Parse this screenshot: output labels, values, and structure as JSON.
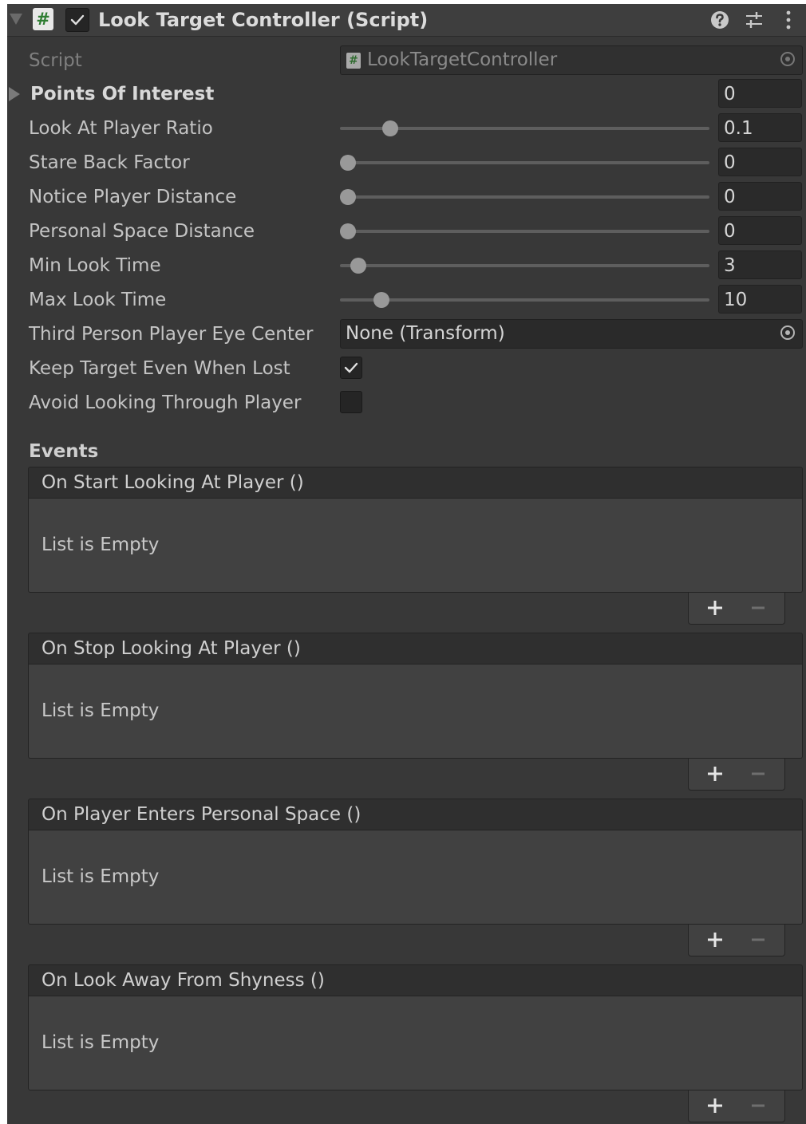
{
  "component": {
    "title": "Look Target Controller (Script)",
    "script_icon_glyph": "#",
    "enabled": true,
    "header_icons": [
      "help-icon",
      "presets-icon",
      "kebab-menu-icon"
    ]
  },
  "script_field": {
    "label": "Script",
    "value": "LookTargetController"
  },
  "points_of_interest": {
    "label": "Points Of Interest",
    "count": "0"
  },
  "sliders": [
    {
      "label": "Look At Player Ratio",
      "value": "0.1",
      "fraction": 0.12
    },
    {
      "label": "Stare Back Factor",
      "value": "0",
      "fraction": 0.0
    },
    {
      "label": "Notice Player Distance",
      "value": "0",
      "fraction": 0.0
    },
    {
      "label": "Personal Space Distance",
      "value": "0",
      "fraction": 0.0
    },
    {
      "label": "Min Look Time",
      "value": "3",
      "fraction": 0.03
    },
    {
      "label": "Max Look Time",
      "value": "10",
      "fraction": 0.095
    }
  ],
  "eye_center": {
    "label": "Third Person Player Eye Center",
    "value": "None (Transform)"
  },
  "toggles": [
    {
      "label": "Keep Target Even When Lost",
      "checked": true
    },
    {
      "label": "Avoid Looking Through Player",
      "checked": false
    }
  ],
  "events_label": "Events",
  "events": [
    {
      "title": "On Start Looking At Player ()",
      "body": "List is Empty"
    },
    {
      "title": "On Stop Looking At Player ()",
      "body": "List is Empty"
    },
    {
      "title": "On Player Enters Personal Space ()",
      "body": "List is Empty"
    },
    {
      "title": "On Look Away From Shyness ()",
      "body": "List is Empty"
    }
  ],
  "colors": {
    "panel_bg": "#383838",
    "field_bg": "#2a2a2a",
    "text": "#c4c4c4",
    "script_icon_green": "#2e7d32"
  }
}
